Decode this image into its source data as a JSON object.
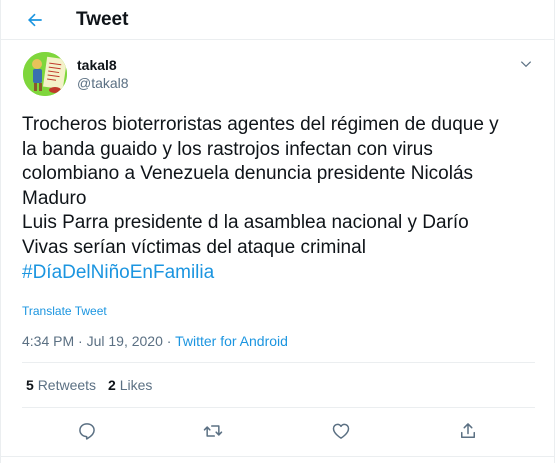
{
  "header": {
    "title": "Tweet",
    "back_icon": "arrow-left-icon"
  },
  "tweet": {
    "author": {
      "display_name": "takal8",
      "handle": "@takal8",
      "avatar_color": "#7fd63c"
    },
    "text_lines": [
      "Trocheros bioterroristas agentes del régimen de duque y",
      "la banda guaido y los rastrojos infectan con virus",
      "colombiano a Venezuela denuncia presidente Nicolás",
      "Maduro",
      "Luis Parra presidente d la asamblea nacional y Darío",
      "Vivas serían víctimas del ataque criminal"
    ],
    "hashtag": "#DíaDelNiñoEnFamilia",
    "translate_label": "Translate Tweet",
    "time": "4:34 PM",
    "separator": " · ",
    "date": "Jul 19, 2020",
    "source": "Twitter for Android",
    "stats": {
      "retweets_count": "5",
      "retweets_label": "Retweets",
      "likes_count": "2",
      "likes_label": "Likes"
    }
  },
  "actions": [
    {
      "name": "reply",
      "icon": "reply-icon"
    },
    {
      "name": "retweet",
      "icon": "retweet-icon"
    },
    {
      "name": "like",
      "icon": "heart-icon"
    },
    {
      "name": "share",
      "icon": "share-icon"
    }
  ],
  "colors": {
    "accent": "#1b95e0",
    "text": "#0f1419",
    "secondary": "#5b7083",
    "border": "#ebeef0"
  }
}
